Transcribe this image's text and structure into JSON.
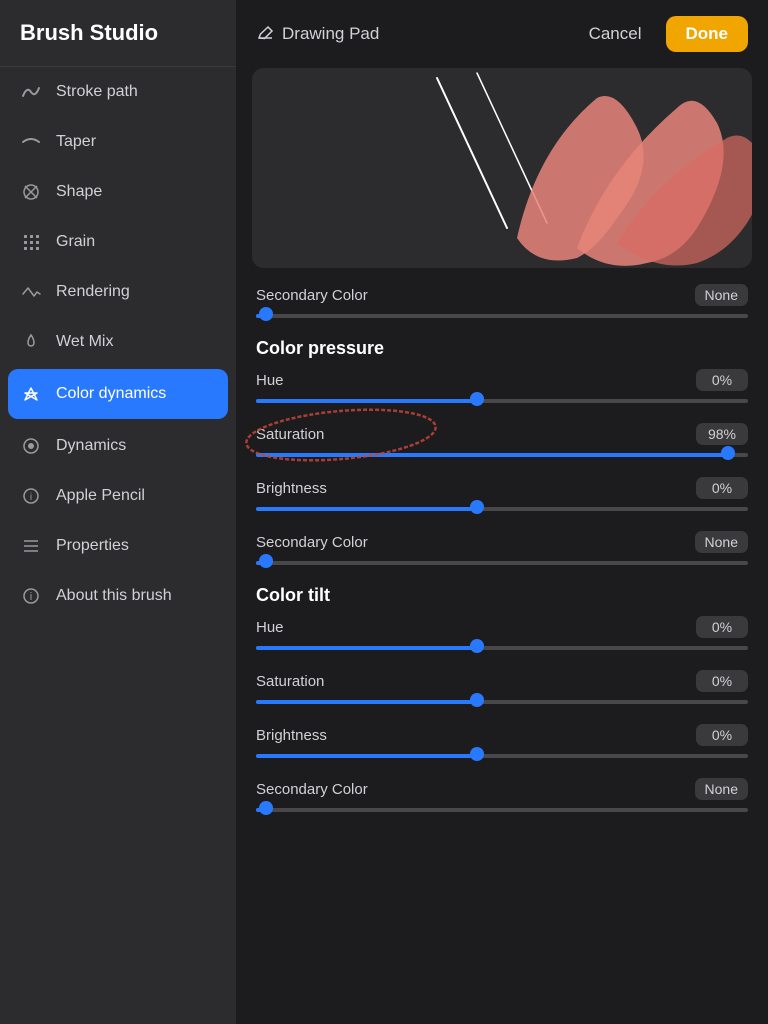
{
  "app": {
    "title": "Brush Studio"
  },
  "header": {
    "drawing_pad_label": "Drawing Pad",
    "cancel_label": "Cancel",
    "done_label": "Done"
  },
  "sidebar": {
    "items": [
      {
        "id": "stroke-path",
        "label": "Stroke path",
        "icon": "stroke"
      },
      {
        "id": "taper",
        "label": "Taper",
        "icon": "taper"
      },
      {
        "id": "shape",
        "label": "Shape",
        "icon": "shape"
      },
      {
        "id": "grain",
        "label": "Grain",
        "icon": "grain"
      },
      {
        "id": "rendering",
        "label": "Rendering",
        "icon": "rendering"
      },
      {
        "id": "wet-mix",
        "label": "Wet Mix",
        "icon": "wetmix"
      },
      {
        "id": "color-dynamics",
        "label": "Color dynamics",
        "icon": "color",
        "active": true
      },
      {
        "id": "dynamics",
        "label": "Dynamics",
        "icon": "dynamics"
      },
      {
        "id": "apple-pencil",
        "label": "Apple Pencil",
        "icon": "pencil"
      },
      {
        "id": "properties",
        "label": "Properties",
        "icon": "properties"
      },
      {
        "id": "about",
        "label": "About this brush",
        "icon": "about"
      }
    ]
  },
  "secondary_color_top": {
    "label": "Secondary Color",
    "value": "None",
    "fill_percent": 2
  },
  "color_pressure": {
    "title": "Color pressure",
    "hue": {
      "label": "Hue",
      "value": "0%",
      "fill_percent": 45
    },
    "saturation": {
      "label": "Saturation",
      "value": "98%",
      "fill_percent": 96
    },
    "brightness": {
      "label": "Brightness",
      "value": "0%",
      "fill_percent": 45
    },
    "secondary_color": {
      "label": "Secondary Color",
      "value": "None",
      "fill_percent": 2
    }
  },
  "color_tilt": {
    "title": "Color tilt",
    "hue": {
      "label": "Hue",
      "value": "0%",
      "fill_percent": 45
    },
    "saturation": {
      "label": "Saturation",
      "value": "0%",
      "fill_percent": 45
    },
    "brightness": {
      "label": "Brightness",
      "value": "0%",
      "fill_percent": 45
    },
    "secondary_color": {
      "label": "Secondary Color",
      "value": "None",
      "fill_percent": 2
    }
  }
}
